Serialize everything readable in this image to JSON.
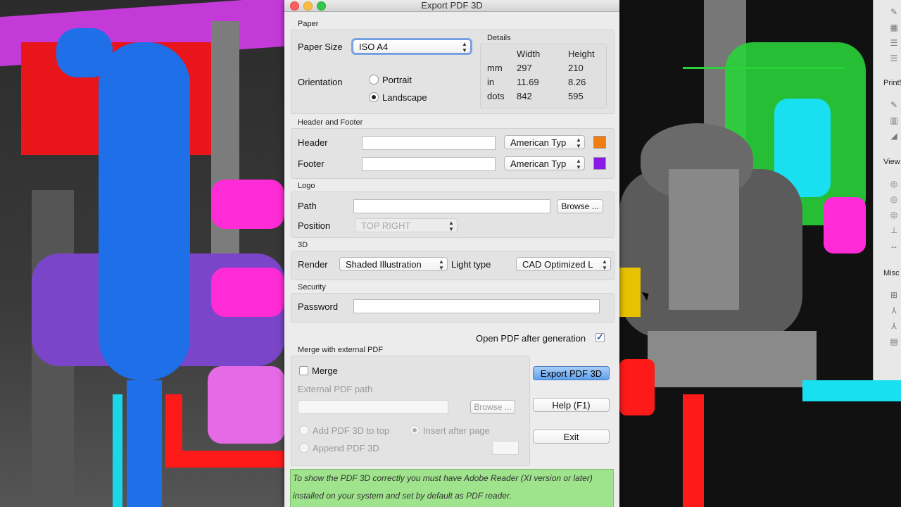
{
  "window": {
    "title": "Export PDF 3D"
  },
  "paper": {
    "section": "Paper",
    "paper_size_label": "Paper Size",
    "paper_size_value": "ISO A4",
    "orientation_label": "Orientation",
    "portrait": "Portrait",
    "landscape": "Landscape",
    "selected_orientation": "Landscape",
    "details": {
      "title": "Details",
      "col_width": "Width",
      "col_height": "Height",
      "rows": [
        {
          "unit": "mm",
          "width": "297",
          "height": "210"
        },
        {
          "unit": "in",
          "width": "11.69",
          "height": "8.26"
        },
        {
          "unit": "dots",
          "width": "842",
          "height": "595"
        }
      ]
    }
  },
  "header_footer": {
    "section": "Header and Footer",
    "header_label": "Header",
    "header_value": "",
    "header_font": "American Typ",
    "header_color": "#f07d13",
    "footer_label": "Footer",
    "footer_value": "",
    "footer_font": "American Typ",
    "footer_color": "#8a19e8"
  },
  "logo": {
    "section": "Logo",
    "path_label": "Path",
    "path_value": "",
    "browse": "Browse ...",
    "position_label": "Position",
    "position_value": "TOP RIGHT"
  },
  "three_d": {
    "section": "3D",
    "render_label": "Render",
    "render_value": "Shaded Illustration",
    "light_label": "Light type",
    "light_value": "CAD Optimized L"
  },
  "security": {
    "section": "Security",
    "password_label": "Password",
    "password_value": ""
  },
  "open_after": {
    "label": "Open PDF after generation",
    "checked": true,
    "check_glyph": "✓"
  },
  "merge": {
    "section": "Merge with external PDF",
    "merge_label": "Merge",
    "merge_checked": false,
    "external_label": "External PDF path",
    "external_value": "",
    "browse": "Browse ...",
    "add_top": "Add PDF 3D to top",
    "insert_after": "Insert after page",
    "append": "Append PDF 3D",
    "page_value": ""
  },
  "buttons": {
    "export": "Export PDF 3D",
    "help": "Help (F1)",
    "exit": "Exit"
  },
  "notice": {
    "line1": "To show the PDF 3D correctly you must have Adobe Reader (XI version or later)",
    "line2": "installed on your system and set by default as PDF reader."
  },
  "side_panel": {
    "print_label": "Print5",
    "view_label": "View",
    "misc_label": "Misc"
  },
  "colors": {
    "accent_button": "#5fa0ec",
    "notice_bg": "#9fe38d",
    "scene_blue": "#1f6fe8",
    "scene_magenta": "#ff2bd6",
    "scene_green": "#29d13a",
    "scene_red": "#ff1a1a"
  }
}
